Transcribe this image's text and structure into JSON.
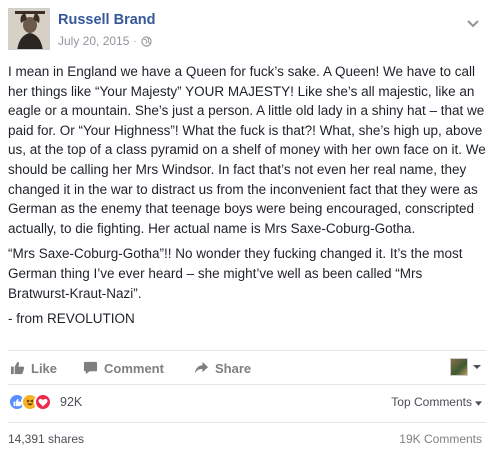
{
  "post": {
    "author": "Russell Brand",
    "date": "July 20, 2015",
    "separator": "·",
    "paragraphs": [
      "I mean in England we have a Queen for fuck’s sake. A Queen! We have to call her things like “Your Majesty” YOUR MAJESTY! Like she’s all majestic, like an eagle or a mountain. She’s just a person. A little old lady in a shiny hat – that we paid for. Or “Your Highness”! What the fuck is that?! What, she’s high up, above us, at the top of a class pyramid on a shelf of money with her own face on it. We should be calling her Mrs Windsor. In fact that’s not even her real name, they changed it in the war to distract us from the inconvenient fact that they were as German as the enemy that teenage boys were being encouraged, conscripted actually, to die fighting. Her actual name is Mrs Saxe-Coburg-Gotha.",
      "“Mrs Saxe-Coburg-Gotha”!! No wonder they fucking changed it. It’s the most German thing I’ve ever heard – she might’ve well as been called “Mrs Bratwurst-Kraut-Nazi”.",
      "- from REVOLUTION"
    ]
  },
  "actions": {
    "like_label": "Like",
    "comment_label": "Comment",
    "share_label": "Share"
  },
  "reactions": {
    "count": "92K",
    "types": [
      "like",
      "haha",
      "love"
    ],
    "colors": {
      "like": "#5890ff",
      "haha": "#f7b125",
      "love": "#f0284a"
    },
    "sort_label": "Top Comments"
  },
  "footer": {
    "shares": "14,391 shares",
    "comments": "19K Comments"
  },
  "theme": {
    "link_color": "#365899",
    "text_color": "#1d2129",
    "muted_color": "#90949c"
  }
}
